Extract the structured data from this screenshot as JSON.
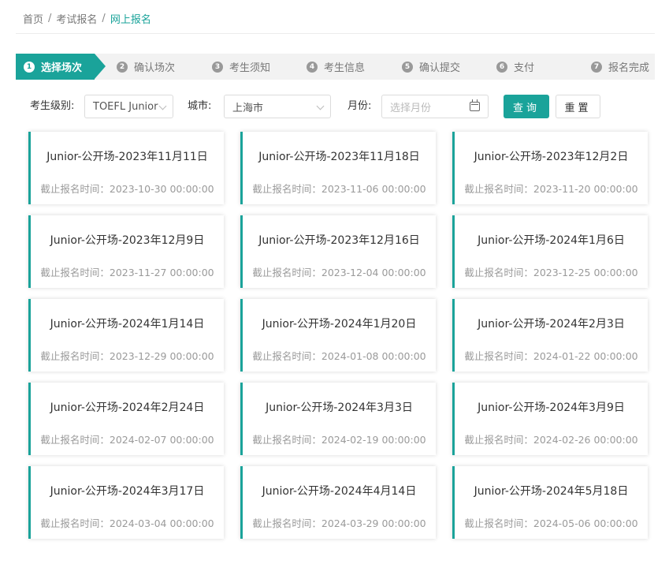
{
  "breadcrumb": {
    "home": "首页",
    "sep1": "/",
    "exam": "考试报名",
    "sep2": "/",
    "current": "网上报名"
  },
  "steps": [
    {
      "num": "1",
      "label": "选择场次",
      "active": true
    },
    {
      "num": "2",
      "label": "确认场次"
    },
    {
      "num": "3",
      "label": "考生须知"
    },
    {
      "num": "4",
      "label": "考生信息"
    },
    {
      "num": "5",
      "label": "确认提交"
    },
    {
      "num": "6",
      "label": "支付"
    },
    {
      "num": "7",
      "label": "报名完成"
    }
  ],
  "filters": {
    "level_label": "考生级别:",
    "level_value": "TOEFL Junior",
    "city_label": "城市:",
    "city_value": "上海市",
    "month_label": "月份:",
    "month_placeholder": "选择月份",
    "search_button": "查询",
    "reset_button": "重置"
  },
  "accent_color": "#1aa39a",
  "deadline_prefix": "截止报名时间：",
  "sessions": [
    {
      "title": "Junior-公开场-2023年11月11日",
      "deadline": "截止报名时间：2023-10-30 00:00:00"
    },
    {
      "title": "Junior-公开场-2023年11月18日",
      "deadline": "截止报名时间：2023-11-06 00:00:00"
    },
    {
      "title": "Junior-公开场-2023年12月2日",
      "deadline": "截止报名时间：2023-11-20 00:00:00"
    },
    {
      "title": "Junior-公开场-2023年12月9日",
      "deadline": "截止报名时间：2023-11-27 00:00:00"
    },
    {
      "title": "Junior-公开场-2023年12月16日",
      "deadline": "截止报名时间：2023-12-04 00:00:00"
    },
    {
      "title": "Junior-公开场-2024年1月6日",
      "deadline": "截止报名时间：2023-12-25 00:00:00"
    },
    {
      "title": "Junior-公开场-2024年1月14日",
      "deadline": "截止报名时间：2023-12-29 00:00:00"
    },
    {
      "title": "Junior-公开场-2024年1月20日",
      "deadline": "截止报名时间：2024-01-08 00:00:00"
    },
    {
      "title": "Junior-公开场-2024年2月3日",
      "deadline": "截止报名时间：2024-01-22 00:00:00"
    },
    {
      "title": "Junior-公开场-2024年2月24日",
      "deadline": "截止报名时间：2024-02-07 00:00:00"
    },
    {
      "title": "Junior-公开场-2024年3月3日",
      "deadline": "截止报名时间：2024-02-19 00:00:00"
    },
    {
      "title": "Junior-公开场-2024年3月9日",
      "deadline": "截止报名时间：2024-02-26 00:00:00"
    },
    {
      "title": "Junior-公开场-2024年3月17日",
      "deadline": "截止报名时间：2024-03-04 00:00:00"
    },
    {
      "title": "Junior-公开场-2024年4月14日",
      "deadline": "截止报名时间：2024-03-29 00:00:00"
    },
    {
      "title": "Junior-公开场-2024年5月18日",
      "deadline": "截止报名时间：2024-05-06 00:00:00"
    }
  ]
}
